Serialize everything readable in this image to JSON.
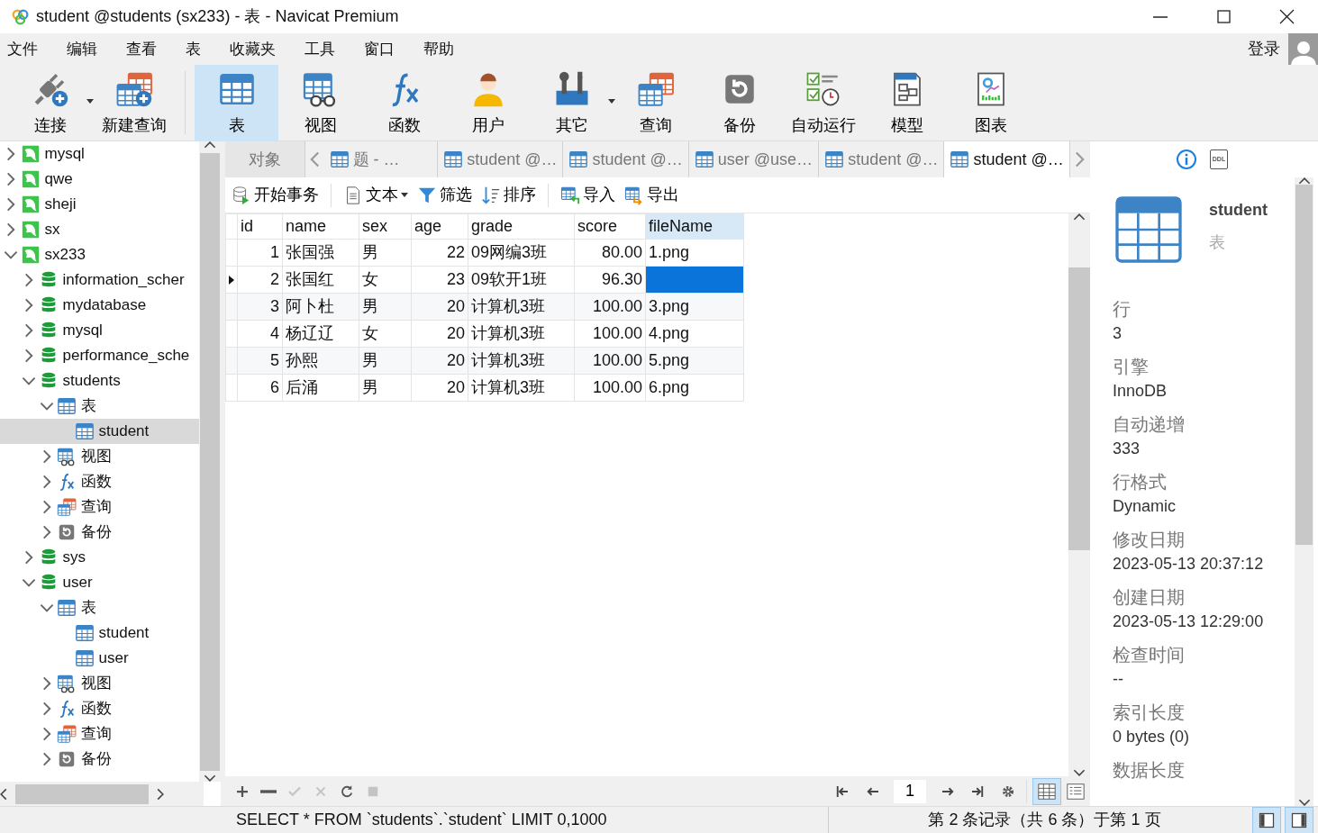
{
  "window": {
    "title": "student @students (sx233) - 表 - Navicat Premium"
  },
  "menu": [
    "文件",
    "编辑",
    "查看",
    "表",
    "收藏夹",
    "工具",
    "窗口",
    "帮助"
  ],
  "account": {
    "label": "登录"
  },
  "toolbar_groups": [
    [
      {
        "label": "连接",
        "kind": "plug",
        "dropdown": true,
        "selected": false
      },
      {
        "label": "新建查询",
        "kind": "newquery",
        "dropdown": false,
        "selected": false
      }
    ],
    [
      {
        "label": "表",
        "kind": "table",
        "dropdown": false,
        "selected": true
      },
      {
        "label": "视图",
        "kind": "view",
        "dropdown": false,
        "selected": false
      },
      {
        "label": "函数",
        "kind": "function",
        "dropdown": false,
        "selected": false
      },
      {
        "label": "用户",
        "kind": "user",
        "dropdown": false,
        "selected": false
      },
      {
        "label": "其它",
        "kind": "tools",
        "dropdown": true,
        "selected": false
      },
      {
        "label": "查询",
        "kind": "query",
        "dropdown": false,
        "selected": false
      },
      {
        "label": "备份",
        "kind": "backup",
        "dropdown": false,
        "selected": false
      },
      {
        "label": "自动运行",
        "kind": "autorun",
        "dropdown": false,
        "selected": false
      },
      {
        "label": "模型",
        "kind": "model",
        "dropdown": false,
        "selected": false
      },
      {
        "label": "图表",
        "kind": "chart",
        "dropdown": false,
        "selected": false
      }
    ]
  ],
  "tree": [
    {
      "label": "mysql",
      "kind": "connection",
      "expanded": false,
      "selected": false
    },
    {
      "label": "qwe",
      "kind": "connection",
      "expanded": false,
      "selected": false
    },
    {
      "label": "sheji",
      "kind": "connection",
      "expanded": false,
      "selected": false
    },
    {
      "label": "sx",
      "kind": "connection",
      "expanded": false,
      "selected": false
    },
    {
      "label": "sx233",
      "kind": "connection",
      "expanded": true,
      "selected": false,
      "children": [
        {
          "label": "information_scher",
          "kind": "db",
          "expanded": false,
          "selected": false
        },
        {
          "label": "mydatabase",
          "kind": "db",
          "expanded": false,
          "selected": false
        },
        {
          "label": "mysql",
          "kind": "db",
          "expanded": false,
          "selected": false
        },
        {
          "label": "performance_sche",
          "kind": "db",
          "expanded": false,
          "selected": false
        },
        {
          "label": "students",
          "kind": "db",
          "expanded": true,
          "selected": false,
          "children": [
            {
              "label": "表",
              "kind": "table",
              "expanded": true,
              "selected": false,
              "children": [
                {
                  "label": "student",
                  "kind": "table",
                  "selected": true
                }
              ]
            },
            {
              "label": "视图",
              "kind": "view",
              "expanded": false,
              "selected": false
            },
            {
              "label": "函数",
              "kind": "function",
              "expanded": false,
              "selected": false
            },
            {
              "label": "查询",
              "kind": "query",
              "expanded": false,
              "selected": false
            },
            {
              "label": "备份",
              "kind": "backup",
              "expanded": false,
              "selected": false
            }
          ]
        },
        {
          "label": "sys",
          "kind": "db",
          "expanded": false,
          "selected": false
        },
        {
          "label": "user",
          "kind": "db",
          "expanded": true,
          "selected": false,
          "children": [
            {
              "label": "表",
              "kind": "table",
              "expanded": true,
              "selected": false,
              "children": [
                {
                  "label": "student",
                  "kind": "table",
                  "selected": false
                },
                {
                  "label": "user",
                  "kind": "table",
                  "selected": false
                }
              ]
            },
            {
              "label": "视图",
              "kind": "view",
              "expanded": false,
              "selected": false
            },
            {
              "label": "函数",
              "kind": "function",
              "expanded": false,
              "selected": false
            },
            {
              "label": "查询",
              "kind": "query",
              "expanded": false,
              "selected": false
            },
            {
              "label": "备份",
              "kind": "backup",
              "expanded": false,
              "selected": false
            }
          ]
        }
      ]
    }
  ],
  "tabs": [
    {
      "label": "对象",
      "kind": "objects",
      "selected": false
    },
    {
      "label": "题 - …",
      "kind": "table",
      "selected": false
    },
    {
      "label": "student @…",
      "kind": "table",
      "selected": false
    },
    {
      "label": "student @…",
      "kind": "table",
      "selected": false
    },
    {
      "label": "user @use…",
      "kind": "table",
      "selected": false
    },
    {
      "label": "student @…",
      "kind": "table",
      "selected": false
    },
    {
      "label": "student @…",
      "kind": "table",
      "selected": true
    }
  ],
  "data_toolbar_groups": [
    [
      {
        "label": "开始事务",
        "kind": "transaction",
        "dropdown": false
      }
    ],
    [
      {
        "label": "文本",
        "kind": "text",
        "dropdown": true
      },
      {
        "label": "筛选",
        "kind": "filter",
        "dropdown": false
      },
      {
        "label": "排序",
        "kind": "sort",
        "dropdown": false
      }
    ],
    [
      {
        "label": "导入",
        "kind": "import",
        "dropdown": false
      },
      {
        "label": "导出",
        "kind": "export",
        "dropdown": false
      }
    ]
  ],
  "table": {
    "columns": [
      {
        "label": "id",
        "selected": false
      },
      {
        "label": "name",
        "selected": false
      },
      {
        "label": "sex",
        "selected": false
      },
      {
        "label": "age",
        "selected": false
      },
      {
        "label": "grade",
        "selected": false
      },
      {
        "label": "score",
        "selected": false
      },
      {
        "label": "fileName",
        "selected": true
      }
    ],
    "rows": [
      {
        "selected": false,
        "cells": [
          "1",
          "张国强",
          "男",
          "22",
          "09网编3班",
          "80.00",
          "1.png"
        ]
      },
      {
        "selected": true,
        "cells": [
          "2",
          "张国红",
          "女",
          "23",
          "09软开1班",
          "96.30",
          null
        ]
      },
      {
        "selected": false,
        "cells": [
          "3",
          "阿卜杜",
          "男",
          "20",
          "计算机3班",
          "100.00",
          "3.png"
        ]
      },
      {
        "selected": false,
        "cells": [
          "4",
          "杨辽辽",
          "女",
          "20",
          "计算机3班",
          "100.00",
          "4.png"
        ]
      },
      {
        "selected": false,
        "cells": [
          "5",
          "孙熙",
          "男",
          "20",
          "计算机3班",
          "100.00",
          "5.png"
        ]
      },
      {
        "selected": false,
        "cells": [
          "6",
          "后涌",
          "男",
          "20",
          "计算机3班",
          "100.00",
          "6.png"
        ]
      }
    ]
  },
  "edit_buttons": [
    {
      "kind": "add",
      "disabled": false
    },
    {
      "kind": "remove",
      "disabled": false
    },
    {
      "kind": "apply",
      "disabled": true
    },
    {
      "kind": "cancel",
      "disabled": true
    },
    {
      "kind": "refresh",
      "disabled": false
    },
    {
      "kind": "stop",
      "disabled": true
    }
  ],
  "pager": {
    "page": "1"
  },
  "views": [
    {
      "kind": "grid",
      "selected": true
    },
    {
      "kind": "form",
      "selected": false
    }
  ],
  "info": {
    "tabs": [
      {
        "kind": "info",
        "selected": true
      },
      {
        "kind": "ddl",
        "label": "DDL",
        "selected": false
      }
    ],
    "name": "student",
    "type": "表",
    "fields": [
      {
        "label": "行",
        "value": "3"
      },
      {
        "label": "引擎",
        "value": "InnoDB"
      },
      {
        "label": "自动递增",
        "value": "333"
      },
      {
        "label": "行格式",
        "value": "Dynamic"
      },
      {
        "label": "修改日期",
        "value": "2023-05-13 20:37:12"
      },
      {
        "label": "创建日期",
        "value": "2023-05-13 12:29:00"
      },
      {
        "label": "检查时间",
        "value": "--"
      },
      {
        "label": "索引长度",
        "value": "0 bytes (0)"
      },
      {
        "label": "数据长度"
      }
    ]
  },
  "status": {
    "sql": "SELECT * FROM `students`.`student` LIMIT 0,1000",
    "record": "第 2 条记录（共 6 条）于第 1 页",
    "panes": [
      {
        "kind": "left",
        "selected": true
      },
      {
        "kind": "right",
        "selected": true
      }
    ]
  }
}
